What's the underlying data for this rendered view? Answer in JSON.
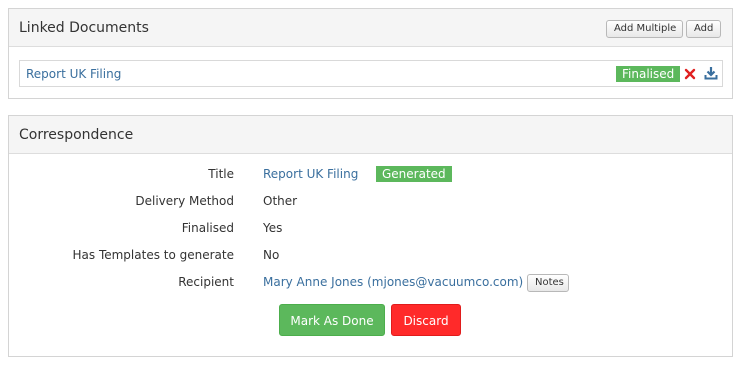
{
  "linked_documents": {
    "title": "Linked Documents",
    "add_multiple_label": "Add Multiple",
    "add_label": "Add",
    "items": [
      {
        "name": "Report UK Filing",
        "status": "Finalised"
      }
    ]
  },
  "correspondence": {
    "title": "Correspondence",
    "fields": {
      "title_label": "Title",
      "title_value": "Report UK Filing",
      "title_status": "Generated",
      "delivery_label": "Delivery Method",
      "delivery_value": "Other",
      "finalised_label": "Finalised",
      "finalised_value": "Yes",
      "templates_label": "Has Templates to generate",
      "templates_value": "No",
      "recipient_label": "Recipient",
      "recipient_value": "Mary Anne Jones (mjones@vacuumco.com)",
      "notes_label": "Notes"
    },
    "mark_done_label": "Mark As Done",
    "discard_label": "Discard"
  },
  "colors": {
    "link": "#3a6f9e",
    "success": "#5cb85c",
    "danger": "#ff2a2a",
    "delete_icon": "#e02020",
    "download_icon": "#3a6f9e"
  },
  "icons": {
    "delete": "close-icon",
    "download": "download-icon"
  }
}
